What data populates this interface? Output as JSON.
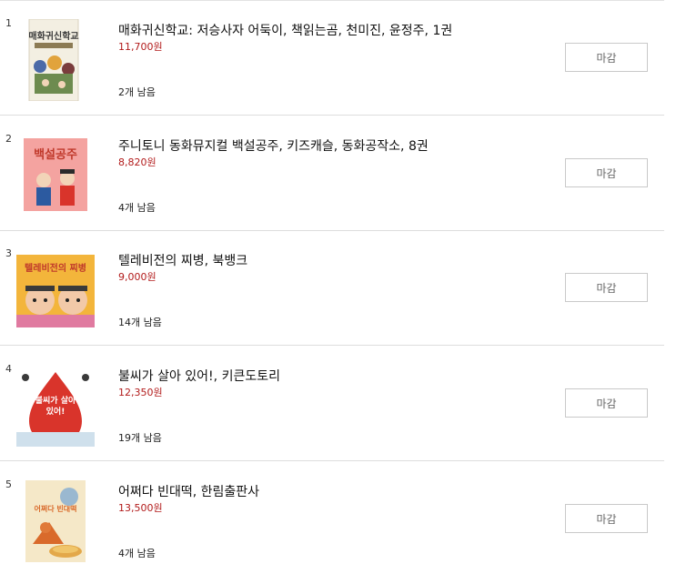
{
  "items": [
    {
      "rank": "1",
      "title": "매화귀신학교: 저승사자 어둑이, 책읽는곰, 천미진, 윤정주, 1권",
      "price": "11,700원",
      "stock": "2개 남음",
      "button": "마감",
      "cover_text": "매화귀신학교",
      "cover_colors": [
        "#f3efe2",
        "#3a3a3a"
      ]
    },
    {
      "rank": "2",
      "title": "주니토니 동화뮤지컬 백설공주, 키즈캐슬, 동화공작소, 8권",
      "price": "8,820원",
      "stock": "4개 남음",
      "button": "마감",
      "cover_text": "백설공주",
      "cover_colors": [
        "#f4a3a0",
        "#c0392b"
      ]
    },
    {
      "rank": "3",
      "title": "텔레비전의 찌병, 북뱅크",
      "price": "9,000원",
      "stock": "14개 남음",
      "button": "마감",
      "cover_text": "텔레비전의 찌병",
      "cover_colors": [
        "#f3b53b",
        "#c0392b"
      ]
    },
    {
      "rank": "4",
      "title": "불씨가 살아 있어!, 키큰도토리",
      "price": "12,350원",
      "stock": "19개 남음",
      "button": "마감",
      "cover_text": "불씨가 살아 있어!",
      "cover_colors": [
        "#ffffff",
        "#d9342b"
      ]
    },
    {
      "rank": "5",
      "title": "어쩌다 빈대떡, 한림출판사",
      "price": "13,500원",
      "stock": "4개 남음",
      "button": "마감",
      "cover_text": "어쩌다 빈대떡",
      "cover_colors": [
        "#f5e8c8",
        "#d96a2b"
      ]
    }
  ]
}
